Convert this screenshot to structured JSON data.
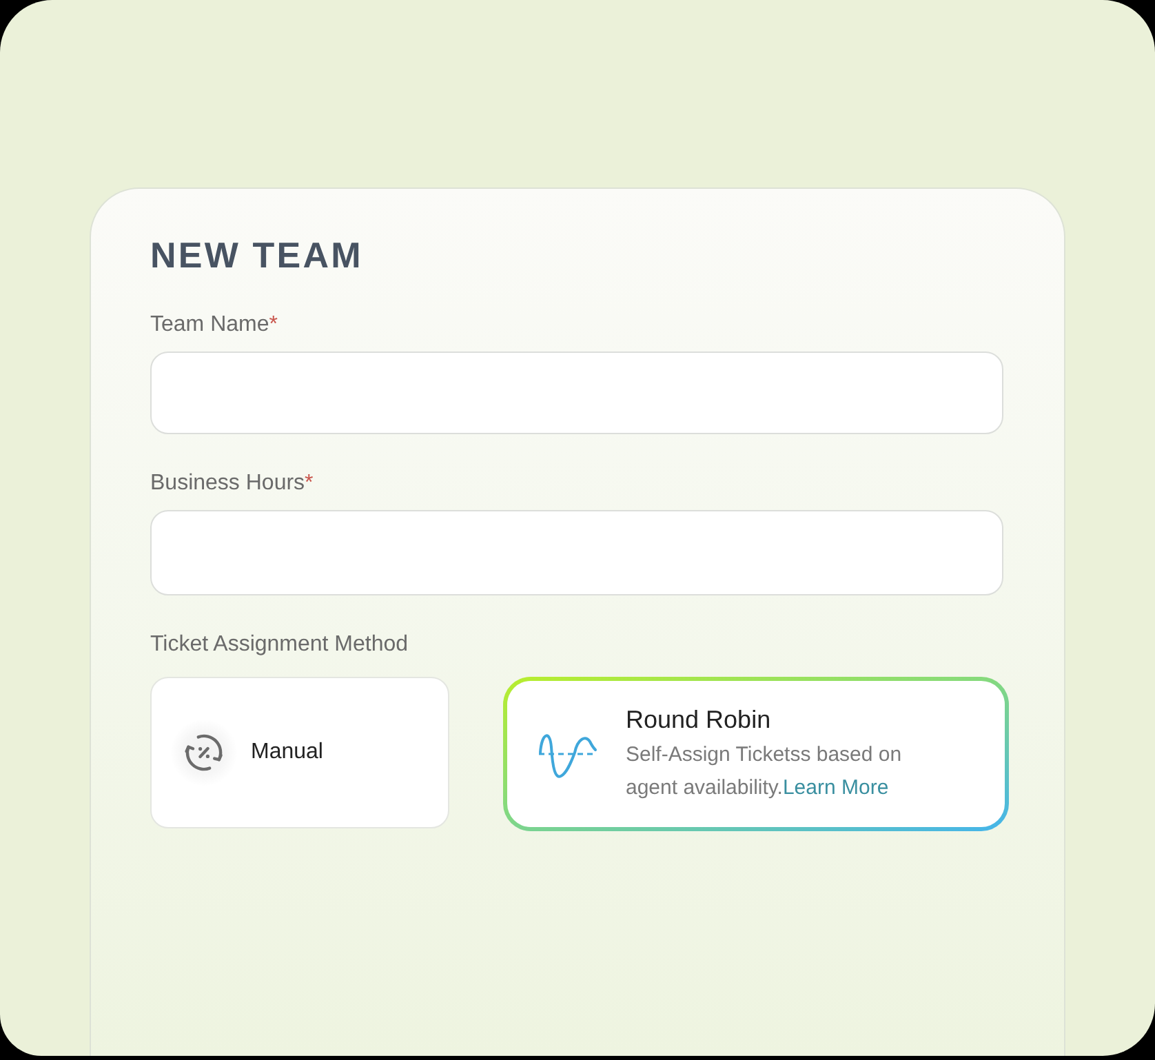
{
  "card": {
    "title": "NEW TEAM",
    "fields": [
      {
        "label": "Team Name",
        "required_mark": "*"
      },
      {
        "label": "Business Hours",
        "required_mark": "*"
      }
    ],
    "assignment": {
      "label": "Ticket Assignment Method",
      "options": [
        {
          "kind": "compact",
          "title": "Manual",
          "selected": false
        },
        {
          "kind": "detailed",
          "title": "Round Robin",
          "description": "Self-Assign Ticketss based on agent availability.",
          "link": "Learn More",
          "selected": true
        }
      ]
    }
  }
}
